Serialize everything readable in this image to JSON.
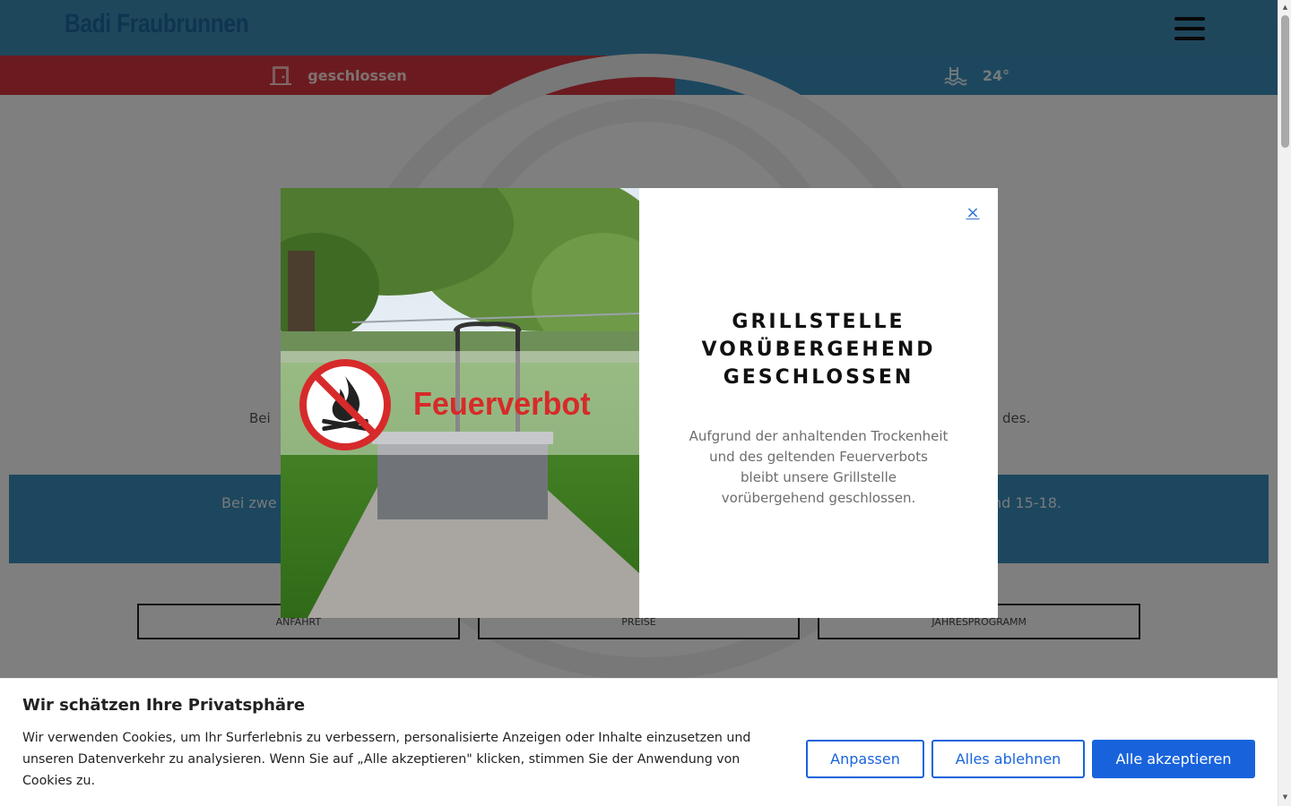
{
  "header": {
    "logo_text": "Badi Fraubrunnen",
    "menu_icon": "hamburger-menu-icon"
  },
  "status": {
    "closed_label": "geschlossen",
    "closed_icon": "door-closed-icon",
    "temperature_label": "24°",
    "temperature_icon": "pool-icon"
  },
  "page": {
    "intro_left": "Bei",
    "intro_right": "des.",
    "band_left": "Bei zwe",
    "band_right": "nd 15-18.",
    "buttons": [
      "ANFAHRT",
      "PREISE",
      "JAHRESPROGRAMM"
    ]
  },
  "modal": {
    "image_label": "Feuerverbot",
    "close_icon": "close-icon",
    "close_glyph": "×",
    "title": "GRILLSTELLE VORÜBERGEHEND GESCHLOSSEN",
    "text": "Aufgrund der anhaltenden Trockenheit und des geltenden Feuerverbots bleibt unsere Grillstelle vorübergehend geschlossen."
  },
  "cookie": {
    "title": "Wir schätzen Ihre Privatsphäre",
    "text": "Wir verwenden Cookies, um Ihr Surferlebnis zu verbessern, personalisierte Anzeigen oder Inhalte einzusetzen und unseren Datenverkehr zu analysieren. Wenn Sie auf „Alle akzeptieren\" klicken, stimmen Sie der Anwendung von Cookies zu.",
    "customize_label": "Anpassen",
    "reject_label": "Alles ablehnen",
    "accept_label": "Alle akzeptieren"
  },
  "colors": {
    "header_blue": "#3f8fb8",
    "closed_red": "#d7373f",
    "temperature_blue": "#3a8fbd",
    "cookie_button_blue": "#1863dc",
    "ban_red": "#d72a2a"
  }
}
